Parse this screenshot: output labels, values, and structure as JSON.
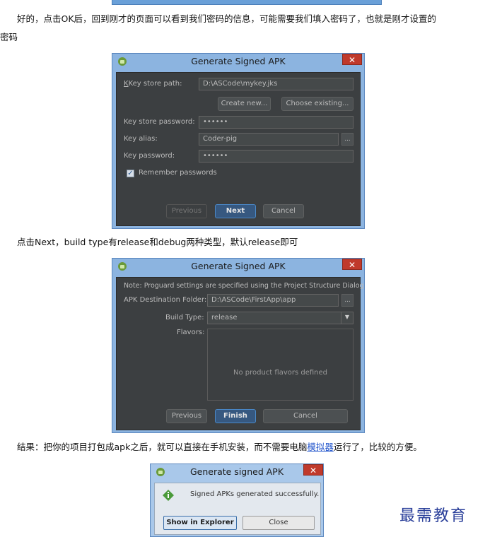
{
  "paragraphs": {
    "p1_line1": "好的，点击OK后，回到刚才的页面可以看到我们密码的信息，可能需要我们填入密码了，也就是刚才设置的",
    "p1_line2": "密码",
    "p2": "点击Next，build type有release和debug两种类型，默认release即可",
    "p3_before": "结果：把你的项目打包成apk之后，就可以直接在手机安装，而不需要电脑",
    "p3_link": "模拟器",
    "p3_after": "运行了，比较的方便。"
  },
  "dialog1": {
    "title": "Generate Signed APK",
    "close": "✕",
    "keystore_path_label": "Key store path:",
    "keystore_path_value": "D:\\ASCode\\mykey.jks",
    "create_new": "Create new...",
    "choose_existing": "Choose existing...",
    "keystore_password_label": "Key store password:",
    "keystore_password_value": "••••••",
    "key_alias_label": "Key alias:",
    "key_alias_value": "Coder-pig",
    "browse": "...",
    "key_password_label": "Key password:",
    "key_password_value": "••••••",
    "remember_label": "Remember passwords",
    "remember_checked": "✓",
    "previous": "Previous",
    "next": "Next",
    "cancel": "Cancel"
  },
  "dialog2": {
    "title": "Generate Signed APK",
    "close": "✕",
    "note": "Note: Proguard settings are specified using the Project Structure Dialog",
    "dest_label": "APK Destination Folder:",
    "dest_value": "D:\\ASCode\\FirstApp\\app",
    "browse": "...",
    "build_type_label": "Build Type:",
    "build_type_value": "release",
    "dropdown_arrow": "▼",
    "flavors_label": "Flavors:",
    "flavors_empty": "No product flavors defined",
    "previous": "Previous",
    "finish": "Finish",
    "cancel": "Cancel"
  },
  "dialog3": {
    "title": "Generate signed APK",
    "close": "✕",
    "message": "Signed APKs generated successfully.",
    "show_in_explorer": "Show in Explorer",
    "close_button": "Close"
  },
  "watermark": "最需教育",
  "colors": {
    "ide_dark": "#3c3f41",
    "window_frame": "#8cb4e0",
    "close_red": "#c0392b",
    "default_button": "#365880",
    "link": "#2255cc"
  }
}
